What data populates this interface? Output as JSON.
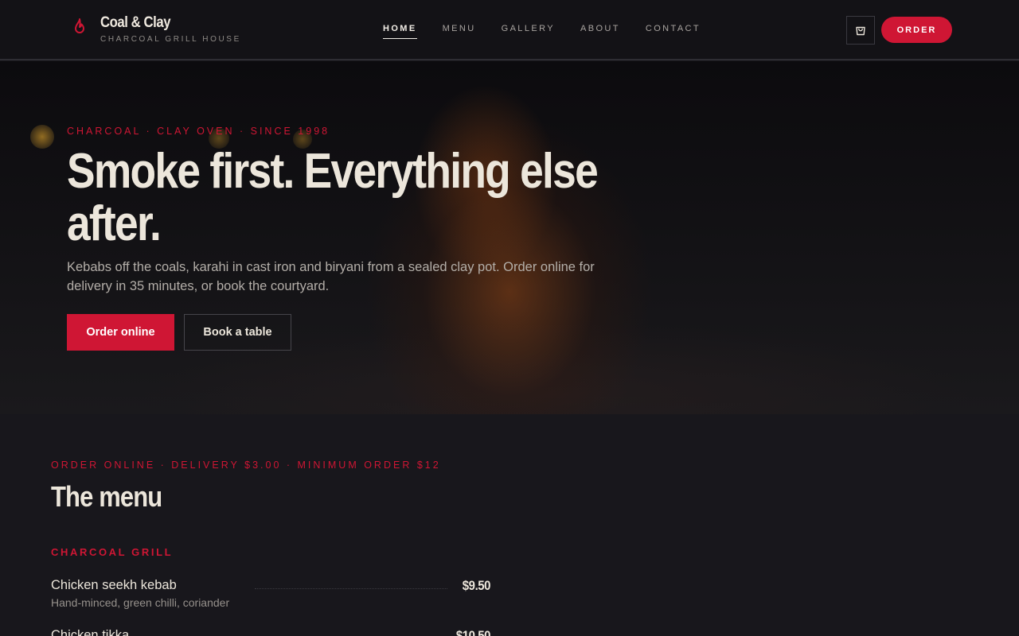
{
  "brand": {
    "name": "Coal & Clay",
    "tagline": "CHARCOAL GRILL HOUSE",
    "icon": "flame-icon"
  },
  "nav": {
    "items": [
      "HOME",
      "MENU",
      "GALLERY",
      "ABOUT",
      "CONTACT"
    ],
    "active": "HOME"
  },
  "header": {
    "cart_icon": "shopping-bag-icon",
    "order_label": "ORDER"
  },
  "hero": {
    "eyebrow": "CHARCOAL · CLAY OVEN · SINCE 1998",
    "title": "Smoke first. Everything else after.",
    "subtitle": "Kebabs off the coals, karahi in cast iron and biryani from a sealed clay pot. Order online for delivery in 35 minutes, or book the courtyard.",
    "primary_cta": "Order online",
    "secondary_cta": "Book a table"
  },
  "menu": {
    "eyebrow": "ORDER ONLINE · DELIVERY $3.00 · MINIMUM ORDER $12",
    "title": "The menu",
    "categories": [
      {
        "name": "CHARCOAL GRILL",
        "items": [
          {
            "name": "Chicken seekh kebab",
            "description": "Hand-minced, green chilli, coriander",
            "price": "$9.50"
          },
          {
            "name": "Chicken tikka",
            "description": "",
            "price": "$10.50"
          }
        ]
      }
    ]
  },
  "colors": {
    "accent": "#cf1634",
    "background": "#18171c",
    "header": "#131216",
    "text": "#ece6db"
  }
}
